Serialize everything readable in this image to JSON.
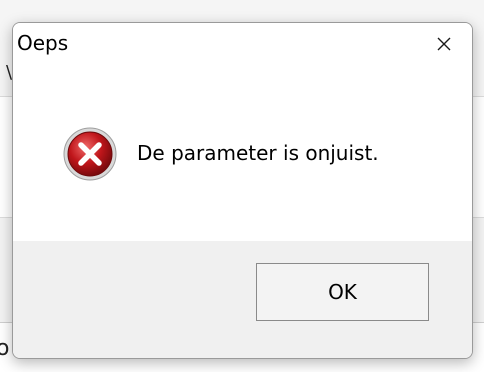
{
  "dialog": {
    "title": "Oeps",
    "message": "De parameter is onjuist.",
    "ok_label": "OK",
    "close_icon": "close-icon",
    "status_icon": "error-icon"
  },
  "colors": {
    "error_red": "#c0161b",
    "titlebar_bg": "#ffffff",
    "footer_bg": "#f0f0f0"
  }
}
